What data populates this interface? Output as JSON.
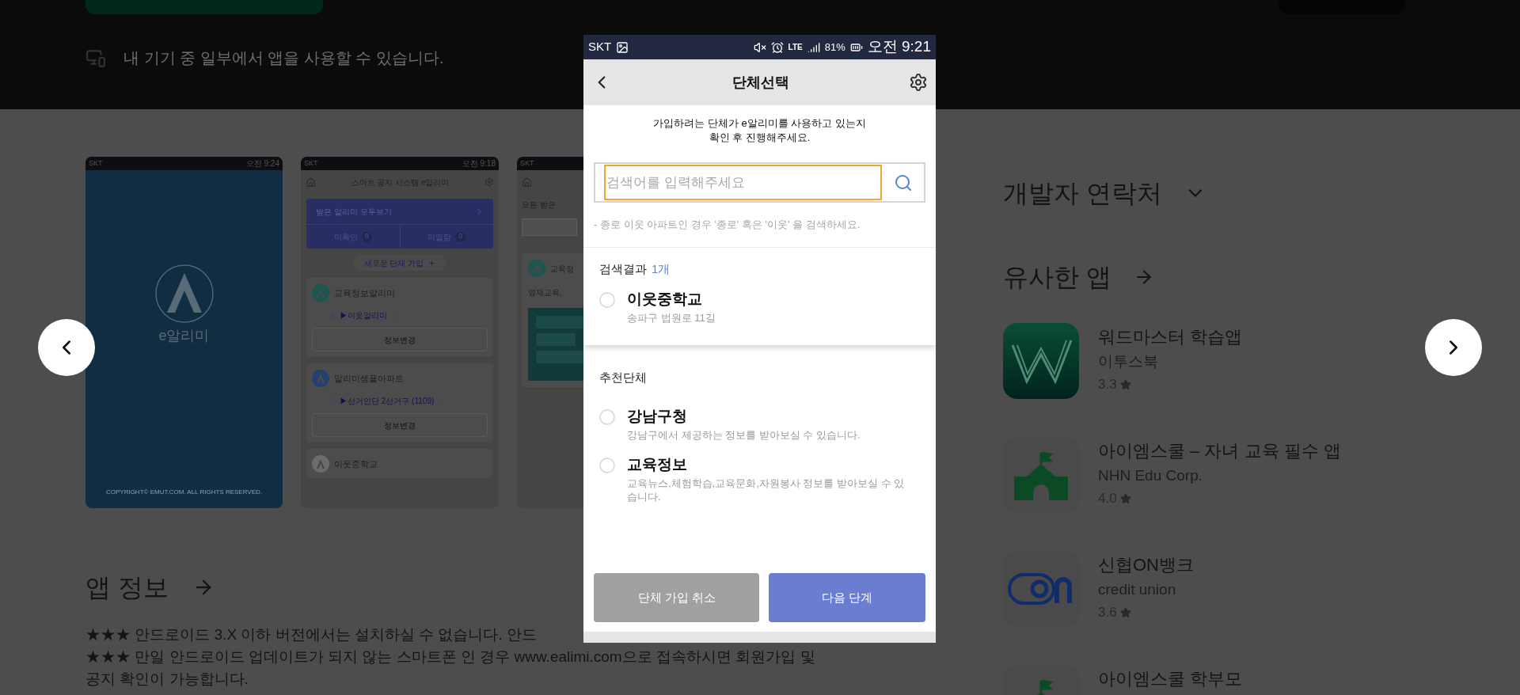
{
  "device_notice": "내 기기 중 일부에서 앱을 사용할 수 있습니다.",
  "screenshots": [
    {
      "kind": "splash",
      "carrier": "SKT",
      "time": "오전 9:24",
      "logo": "e알리미",
      "copyright": "COPYRIGHT© EMUT.COM. ALL RIGHTS RESERVED."
    },
    {
      "kind": "home",
      "carrier": "SKT",
      "time": "오전 9:18",
      "title": "스마트 공지 시스템 e알리미",
      "banner": "받은 알리미 모두보기",
      "counters": [
        {
          "label": "미확인",
          "count": "8"
        },
        {
          "label": "미열람",
          "count": "0"
        }
      ],
      "join": "새로운 단체 가입",
      "groups": [
        {
          "name": "교육정보알리미",
          "member": "▶이웃알리미",
          "action": "정보변경"
        },
        {
          "name": "알리미샘플아파트",
          "member": "▶선거인단 2선거구 (1109)",
          "action": "정보변경"
        },
        {
          "name": "이웃중학교"
        }
      ]
    },
    {
      "kind": "feed",
      "carrier": "SKT",
      "heading": "모든 받은",
      "card_title": "교육정",
      "card_text": "영재교육,"
    }
  ],
  "app_info": {
    "title": "앱 정보",
    "lines": [
      "★★★ 안드로이드 3.X 이하 버전에서는 설치하실 수 없습니다. 안드",
      "★★★ 만일 안드로이드 업데이트가 되지 않는 스마트폰 인 경우 www.ealimi.com으로 접속하시면 회원가입 및",
      "공지 확인이 가능합니다."
    ]
  },
  "developer_contact": {
    "title": "개발자 연락처"
  },
  "similar_apps": {
    "title": "유사한 앱",
    "apps": [
      {
        "name": "워드마스터 학습앱",
        "developer": "이투스북",
        "rating": "3.3"
      },
      {
        "name": "아이엠스쿨 – 자녀 교육 필수 앱",
        "developer": "NHN Edu Corp.",
        "rating": "4.0"
      },
      {
        "name": "신협ON뱅크",
        "developer": "credit union",
        "rating": "3.6"
      },
      {
        "name": "아이엠스쿨 학부모"
      }
    ]
  },
  "dialog": {
    "status_bar": {
      "carrier": "SKT",
      "network": "LTE",
      "battery": "81%",
      "time": "오전 9:21"
    },
    "title": "단체선택",
    "intro_lines": [
      "가입하려는 단체가 e알리미를 사용하고 있는지",
      "확인 후 진행해주세요."
    ],
    "search": {
      "placeholder": "검색어를 입력해주세요"
    },
    "hint": "- 종로 이웃 아파트인 경우 '종로' 혹은 '이웃' 을 검색하세요.",
    "results": {
      "label": "검색결과",
      "count": "1개",
      "items": [
        {
          "name": "이웃중학교",
          "detail": "송파구 법원로 11길",
          "selected": false
        }
      ]
    },
    "recommended": {
      "label": "추천단체",
      "items": [
        {
          "name": "강남구청",
          "detail": "강남구에서 제공하는 정보를 받아보실 수 있습니다.",
          "selected": false
        },
        {
          "name": "교육정보",
          "detail": "교육뉴스,체험학습,교육문화,자원봉사 정보를 받아보실 수 있습니다.",
          "selected": false
        }
      ]
    },
    "buttons": [
      {
        "label": "단체 가입 취소",
        "kind": "secondary"
      },
      {
        "label": "다음 단계",
        "kind": "primary"
      }
    ]
  }
}
